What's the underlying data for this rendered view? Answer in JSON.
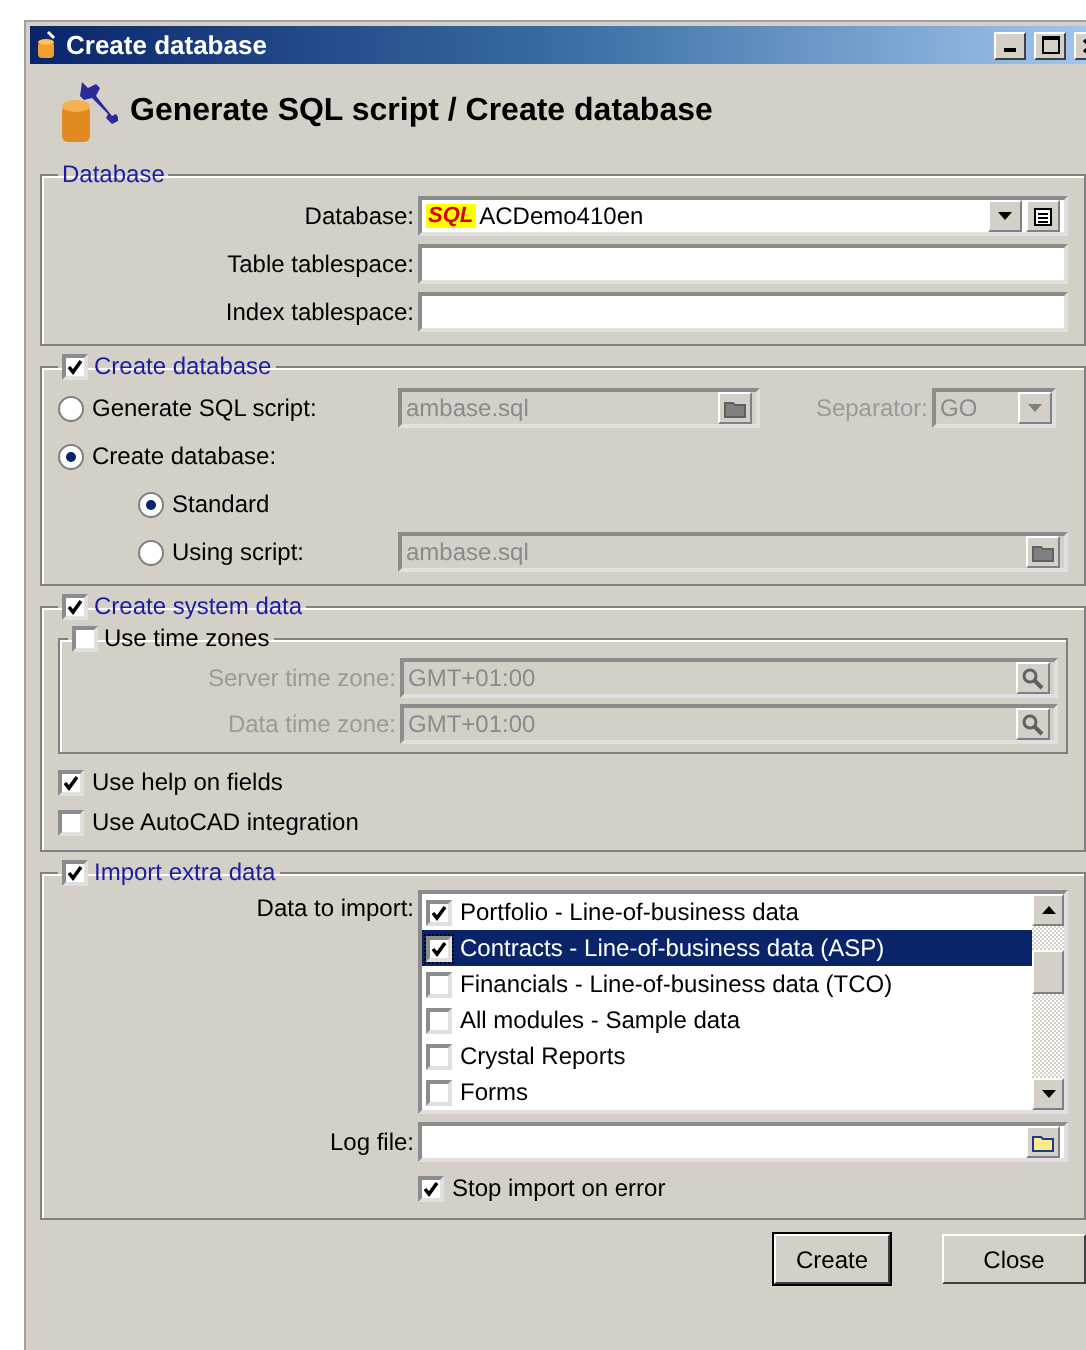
{
  "window": {
    "title": "Create database"
  },
  "header": {
    "title": "Generate SQL script / Create database"
  },
  "database": {
    "title": "Database",
    "fields": [
      {
        "label": "Database:",
        "kind": "combo",
        "logo": "SQL",
        "value": "ACDemo410en"
      },
      {
        "label": "Table tablespace:",
        "kind": "text"
      },
      {
        "label": "Index tablespace:",
        "kind": "text"
      }
    ]
  },
  "create_database": {
    "title": "Create database",
    "checked": true,
    "options": [
      {
        "label": "Generate SQL script:",
        "selected": false,
        "value": "ambase.sql",
        "disabled": true
      },
      {
        "label": "Create database:",
        "selected": true
      }
    ],
    "separator": {
      "label": "Separator:",
      "value": "GO",
      "disabled": true
    },
    "sub_options": [
      {
        "label": "Standard",
        "selected": true
      },
      {
        "label": "Using script:",
        "selected": false,
        "value": "ambase.sql",
        "disabled": true
      }
    ]
  },
  "system_data": {
    "title": "Create system data",
    "checked": true,
    "time_zones": {
      "label": "Use time zones",
      "checked": false,
      "fields": [
        {
          "label": "Server time zone:",
          "value": "GMT+01:00",
          "disabled": true
        },
        {
          "label": "Data time zone:",
          "value": "GMT+01:00",
          "disabled": true
        }
      ]
    },
    "options": [
      {
        "label": "Use help on fields",
        "checked": true
      },
      {
        "label": "Use AutoCAD integration",
        "checked": false
      }
    ]
  },
  "import": {
    "title": "Import extra data",
    "checked": true,
    "list_label": "Data to import:",
    "items": [
      {
        "label": "Portfolio - Line-of-business data",
        "checked": true,
        "selected": false
      },
      {
        "label": "Contracts -  Line-of-business data (ASP)",
        "checked": true,
        "selected": true
      },
      {
        "label": "Financials -  Line-of-business data (TCO)",
        "checked": false,
        "selected": false
      },
      {
        "label": "All modules - Sample data",
        "checked": false,
        "selected": false
      },
      {
        "label": "Crystal Reports",
        "checked": false,
        "selected": false
      },
      {
        "label": "Forms",
        "checked": false,
        "selected": false
      }
    ],
    "log_label": "Log file:",
    "stop": {
      "label": "Stop import on error",
      "checked": true
    }
  },
  "buttons": [
    {
      "label": "Create",
      "default": true
    },
    {
      "label": "Close",
      "default": false
    }
  ]
}
